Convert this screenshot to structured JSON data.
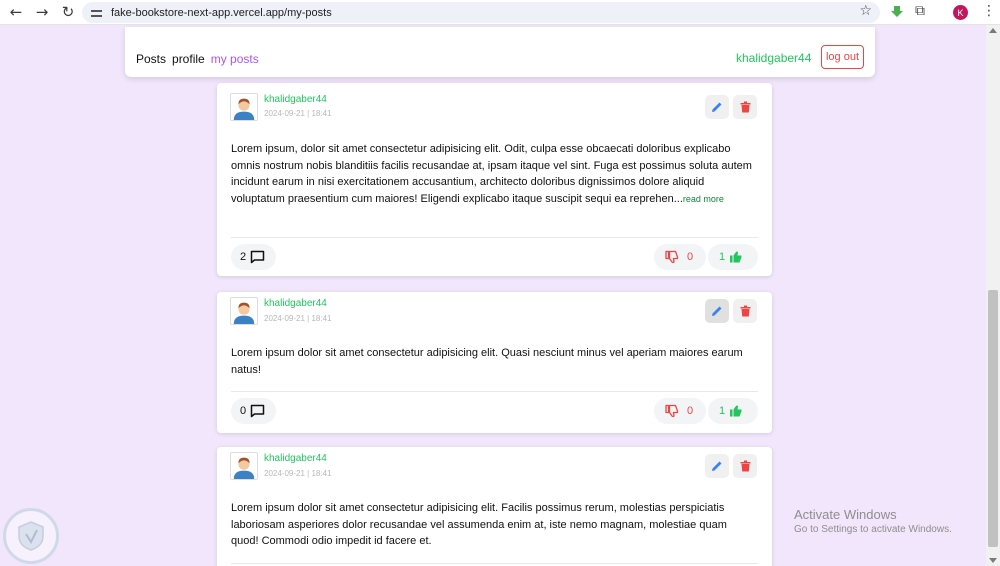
{
  "browser": {
    "url": "fake-bookstore-next-app.vercel.app/my-posts",
    "profile_initial": "K"
  },
  "header": {
    "nav": [
      {
        "label": "Posts",
        "active": false
      },
      {
        "label": "profile",
        "active": false
      },
      {
        "label": "my posts",
        "active": true
      }
    ],
    "username": "khalidgaber44",
    "logout_label": "log out"
  },
  "posts": [
    {
      "author": "khalidgaber44",
      "date": "2024-09-21 | 18:41",
      "body": "Lorem ipsum, dolor sit amet consectetur adipisicing elit. Odit, culpa esse obcaecati doloribus explicabo omnis nostrum nobis blanditiis facilis recusandae at, ipsam itaque vel sint. Fuga est possimus soluta autem incidunt earum in nisi exercitationem accusantium, architecto doloribus dignissimos dolore aliquid voluptatum praesentium cum maiores! Eligendi explicabo itaque suscipit sequi ea reprehen",
      "ellipsis": "...",
      "read_more": "read more",
      "comments": "2",
      "dislikes": "0",
      "likes": "1"
    },
    {
      "author": "khalidgaber44",
      "date": "2024-09-21 | 18:41",
      "body": "Lorem ipsum dolor sit amet consectetur adipisicing elit. Quasi nesciunt minus vel aperiam maiores earum natus!",
      "comments": "0",
      "dislikes": "0",
      "likes": "1"
    },
    {
      "author": "khalidgaber44",
      "date": "2024-09-21 | 18:41",
      "body": "Lorem ipsum dolor sit amet consectetur adipisicing elit. Facilis possimus rerum, molestias perspiciatis laboriosam asperiores dolor recusandae vel assumenda enim at, iste nemo magnam, molestiae quam quod! Commodi odio impedit id facere et."
    }
  ],
  "windows_watermark": {
    "line1": "Activate Windows",
    "line2": "Go to Settings to activate Windows."
  },
  "colors": {
    "accent_purple": "#a855f7",
    "username_green": "#22c55e",
    "danger_red": "#ef4444",
    "edit_blue": "#3b82f6",
    "page_bg": "#f1e6fb"
  }
}
